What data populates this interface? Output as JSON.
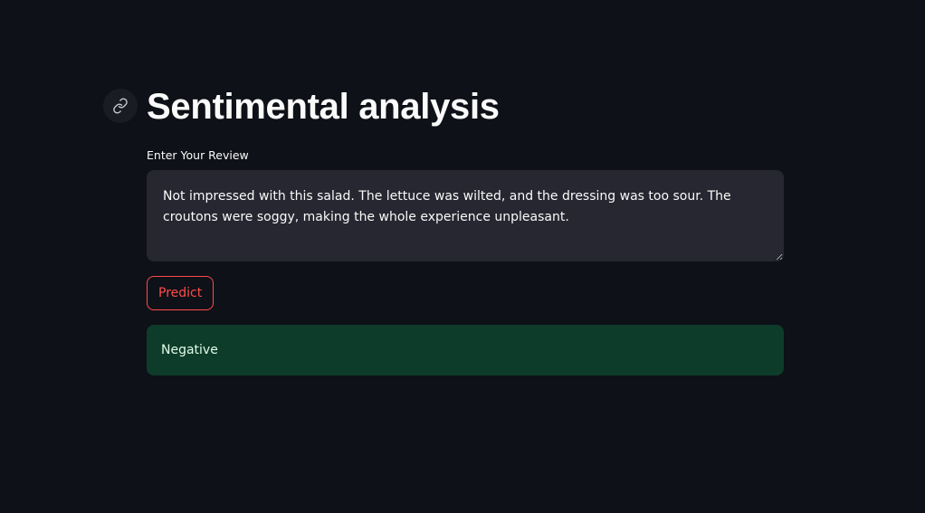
{
  "header": {
    "title": "Sentimental analysis",
    "anchor_icon": "link-icon"
  },
  "form": {
    "review_label": "Enter Your Review",
    "review_value": "Not impressed with this salad. The lettuce was wilted, and the dressing was too sour. The croutons were soggy, making the whole experience unpleasant.",
    "predict_label": "Predict"
  },
  "result": {
    "text": "Negative"
  },
  "colors": {
    "background": "#0e1117",
    "input_background": "#262730",
    "accent": "#ff4b4b",
    "success_background": "#0e3c2a",
    "success_text": "#dffde9"
  }
}
